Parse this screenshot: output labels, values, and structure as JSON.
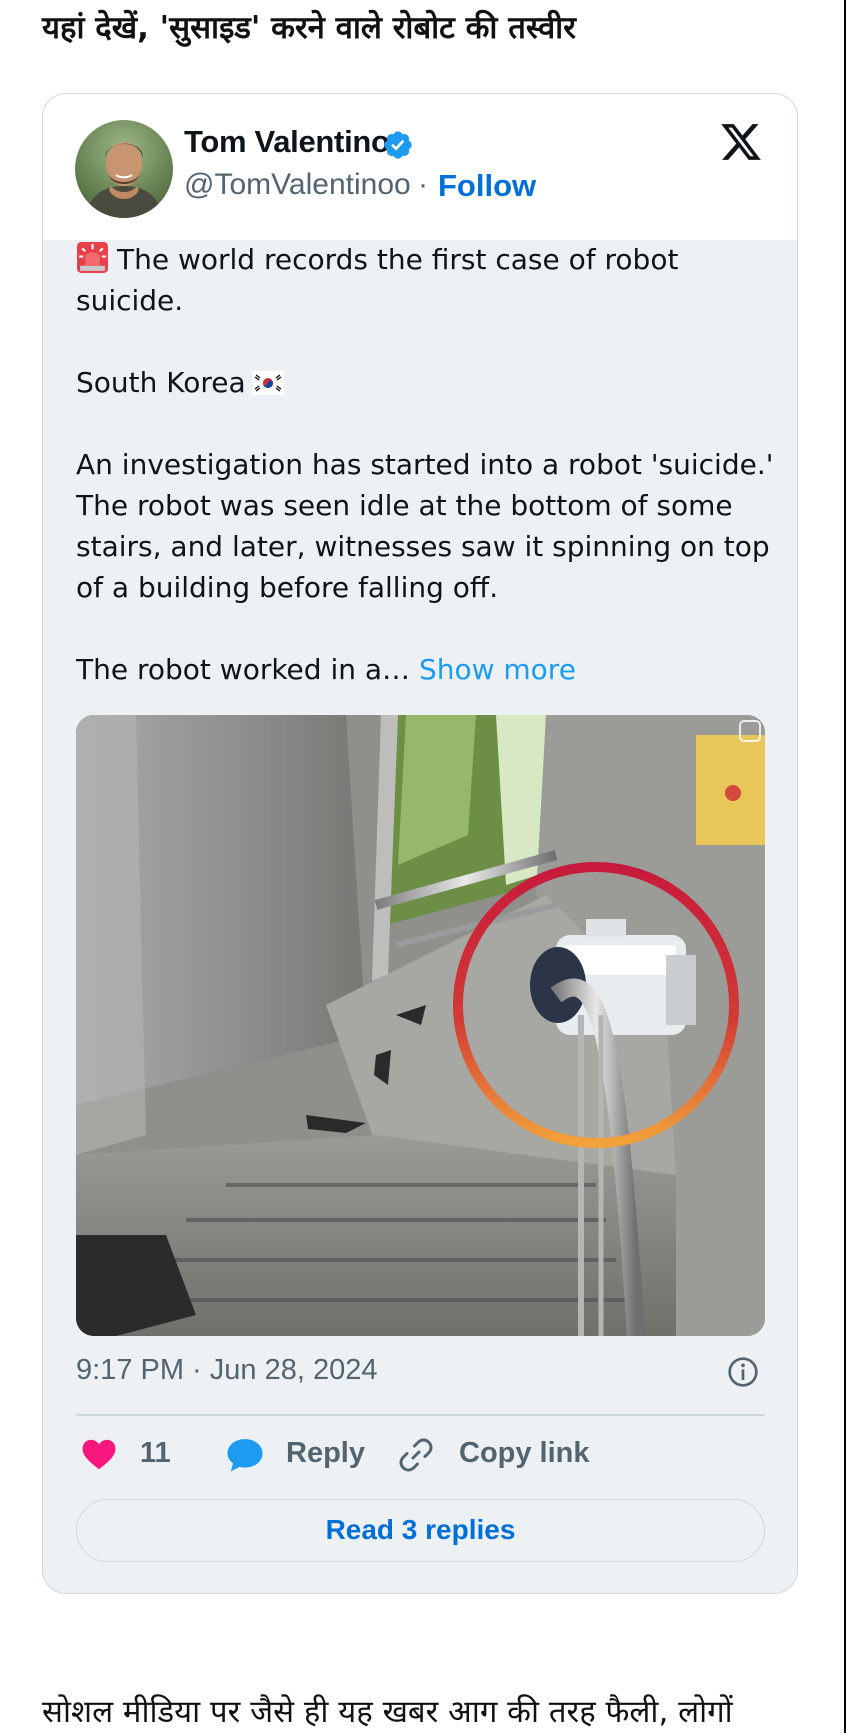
{
  "article": {
    "headline": "यहां देखें, 'सुसाइड' करने वाले रोबोट की तस्वीर",
    "body_partial": "सोशल मीडिया पर जैसे ही यह खबर आग की तरह फैली, लोगों"
  },
  "tweet": {
    "author_name": "Tom Valentino",
    "author_handle": "@TomValentinoo",
    "separator": "·",
    "follow_label": "Follow",
    "verified": true,
    "platform_icon": "x-logo-icon",
    "text_line_1": "The world records the first case of robot suicide.",
    "text_line_2": "South Korea",
    "text_line_3": "An investigation has started into a robot 'suicide.' The robot was seen idle at the bottom of some stairs, and later, witnesses saw it spinning on top of a building before falling off.",
    "text_line_4": "The robot worked in a…",
    "show_more_label": "Show more",
    "timestamp": "9:17 PM · Jun 28, 2024",
    "like_count": "11",
    "reply_label": "Reply",
    "copy_link_label": "Copy link",
    "read_replies_label": "Read 3 replies"
  },
  "colors": {
    "link_blue": "#006fd6",
    "show_more_blue": "#1d9bf0",
    "like_pink": "#f91880",
    "reply_blue": "#1d9bf0",
    "verified_blue": "#1d9bf0",
    "card_bg": "#edf1f4",
    "muted_text": "#536471"
  }
}
